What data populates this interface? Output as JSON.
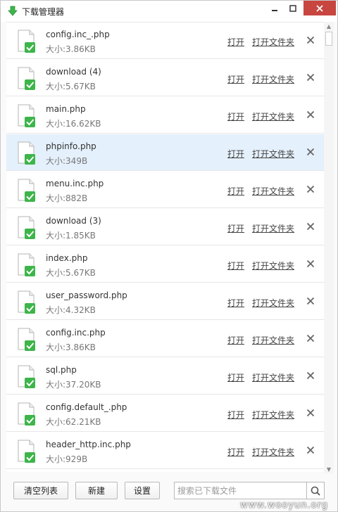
{
  "window": {
    "title": "下载管理器"
  },
  "files": [
    {
      "name": "config.inc_.php",
      "size": "大小:3.86KB",
      "selected": false
    },
    {
      "name": "download (4)",
      "size": "大小:5.67KB",
      "selected": false
    },
    {
      "name": "main.php",
      "size": "大小:16.62KB",
      "selected": false
    },
    {
      "name": "phpinfo.php",
      "size": "大小:349B",
      "selected": true
    },
    {
      "name": "menu.inc.php",
      "size": "大小:882B",
      "selected": false
    },
    {
      "name": "download (3)",
      "size": "大小:1.85KB",
      "selected": false
    },
    {
      "name": "index.php",
      "size": "大小:5.67KB",
      "selected": false
    },
    {
      "name": "user_password.php",
      "size": "大小:4.32KB",
      "selected": false
    },
    {
      "name": "config.inc.php",
      "size": "大小:3.86KB",
      "selected": false
    },
    {
      "name": "sql.php",
      "size": "大小:37.20KB",
      "selected": false
    },
    {
      "name": "config.default_.php",
      "size": "大小:62.21KB",
      "selected": false
    },
    {
      "name": "header_http.inc.php",
      "size": "大小:929B",
      "selected": false
    }
  ],
  "row_actions": {
    "open_label": "打开",
    "open_folder_label": "打开文件夹"
  },
  "toolbar": {
    "clear_label": "清空列表",
    "new_label": "新建",
    "settings_label": "设置",
    "search_placeholder": "搜索已下载文件"
  },
  "watermark": "www.wooyun.org",
  "colors": {
    "accent_green": "#3db54a",
    "close_red": "#c7463f",
    "selected_row": "#e4f0fb"
  }
}
